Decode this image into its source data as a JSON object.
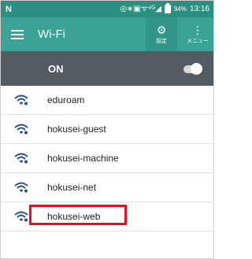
{
  "statusbar": {
    "left_icon": "N",
    "icons_text": "◎∗▣ᯤ⁴ᴳ◢",
    "battery": "94%",
    "time": "13:16"
  },
  "toolbar": {
    "title": "Wi-Fi",
    "settings_label": "設定",
    "menu_label": "メニュー"
  },
  "wifi_toggle": {
    "label": "ON",
    "state": "on"
  },
  "networks": [
    {
      "name": "eduroam"
    },
    {
      "name": "hokusei-guest"
    },
    {
      "name": "hokusei-machine"
    },
    {
      "name": "hokusei-net"
    },
    {
      "name": "hokusei-web",
      "highlighted": true
    }
  ],
  "colors": {
    "statusbar": "#2b8f82",
    "toolbar": "#3aa396",
    "onrow": "#555b63",
    "wifi_icon": "#2a4f8a",
    "highlight": "#e0121f"
  }
}
